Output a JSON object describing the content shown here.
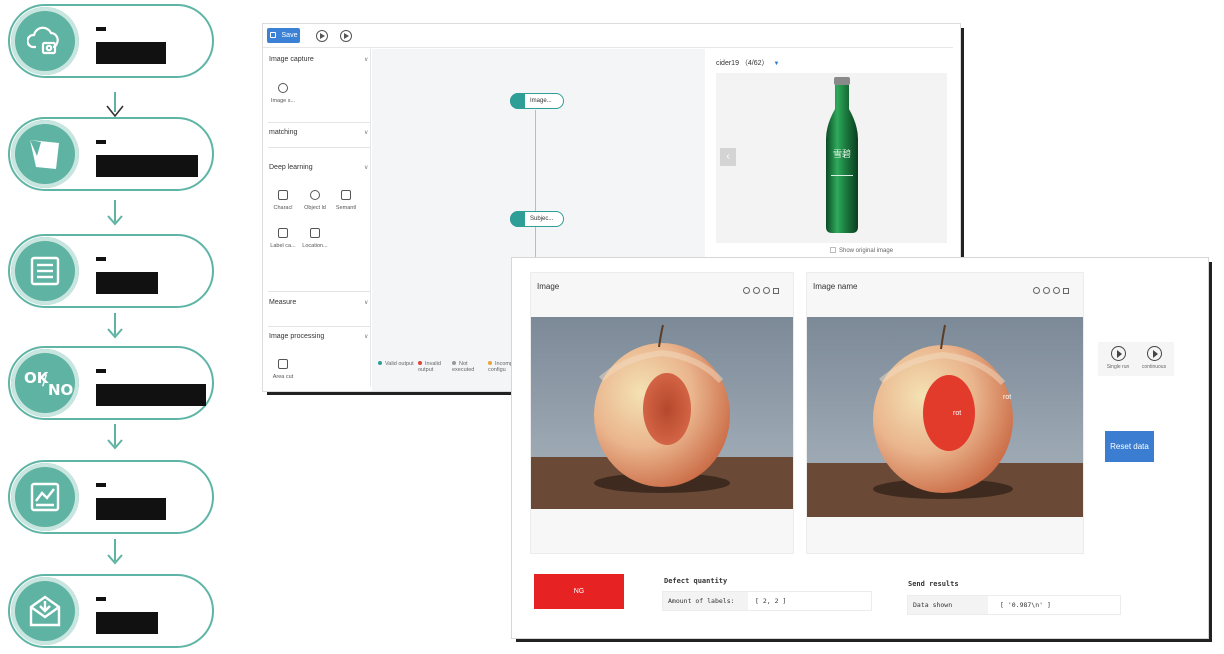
{
  "workflow": {
    "steps": [
      {
        "icon": "cloud-camera-icon"
      },
      {
        "icon": "polygon-crop-icon"
      },
      {
        "icon": "list-document-icon"
      },
      {
        "icon": "ok-no-icon",
        "ok": "OK",
        "slash": "/",
        "no": "NO"
      },
      {
        "icon": "chart-monitor-icon"
      },
      {
        "icon": "mail-download-icon"
      }
    ]
  },
  "editor": {
    "toolbar": {
      "save_label": "Save",
      "run_icon": "play-icon",
      "debug_icon": "step-play-icon"
    },
    "palette": {
      "image_capture": {
        "title": "Image capture",
        "tools": [
          "Image s..."
        ]
      },
      "matching": {
        "title": "matching"
      },
      "deep_learning": {
        "title": "Deep learning",
        "tools": [
          "Characl",
          "Object ld",
          "Semantl",
          "Label ca...",
          "Location..."
        ]
      },
      "measure": {
        "title": "Measure"
      },
      "image_processing": {
        "title": "Image processing",
        "tools": [
          "Area cut"
        ]
      }
    },
    "canvas": {
      "nodes": [
        "Image...",
        "Subjec..."
      ],
      "legend": [
        {
          "label": "Valid output",
          "color": "#2f9e96"
        },
        {
          "label": "Invalid output",
          "color": "#e0443a"
        },
        {
          "label": "Not executed",
          "color": "#999999"
        },
        {
          "label": "Incomp configu",
          "color": "#e8a33a"
        }
      ]
    },
    "preview": {
      "title": "cider19 （4/62）",
      "bottle_text": "雪碧",
      "show_original_label": "Show original image"
    }
  },
  "inspection": {
    "panels": [
      {
        "title": "Image",
        "labels": []
      },
      {
        "title": "Image name",
        "labels": [
          "rot",
          "rot"
        ]
      }
    ],
    "single_run_label": "Single run",
    "continuous_label": "continuous",
    "reset_label": "Reset data",
    "result_button_label": "NG",
    "defect": {
      "title": "Defect quantity",
      "key": "Amount of labels:",
      "value": "[ 2, 2 ]"
    },
    "send": {
      "title": "Send results",
      "key": "Data shown",
      "value": "[ '0.987\\n' ]"
    }
  },
  "colors": {
    "accent_teal": "#5fb3a3",
    "save_blue": "#3b82d6",
    "reset_blue": "#3a7dd1",
    "ng_red": "#e62222"
  }
}
